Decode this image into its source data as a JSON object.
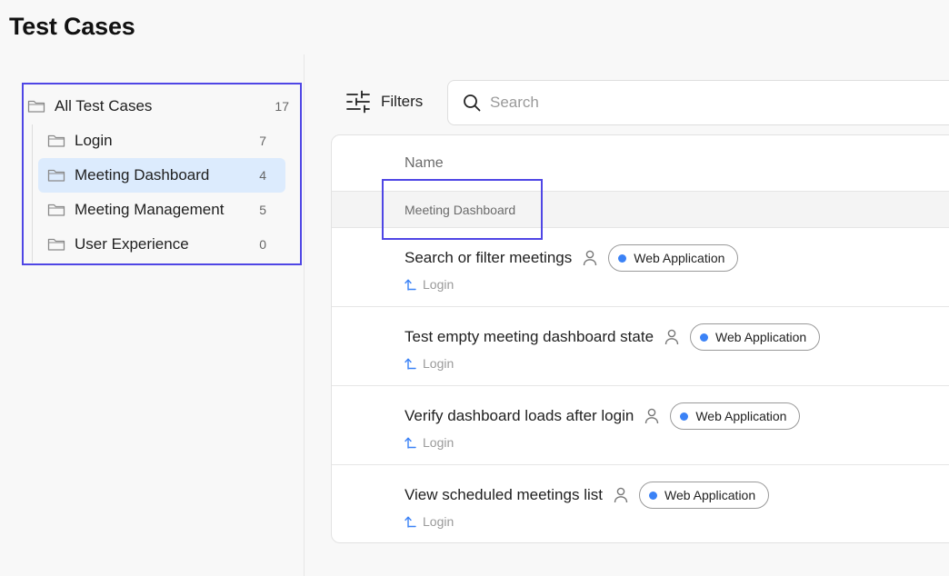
{
  "page": {
    "title": "Test Cases"
  },
  "colors": {
    "accent": "#4f46e5",
    "active_bg": "#dcebfd",
    "badge_dot": "#3b82f6",
    "link_icon": "#3b82f6"
  },
  "sidebar": {
    "root": {
      "label": "All Test Cases",
      "count": "17"
    },
    "items": [
      {
        "label": "Login",
        "count": "7",
        "active": false
      },
      {
        "label": "Meeting Dashboard",
        "count": "4",
        "active": true
      },
      {
        "label": "Meeting Management",
        "count": "5",
        "active": false
      },
      {
        "label": "User Experience",
        "count": "0",
        "active": false
      }
    ]
  },
  "toolbar": {
    "filters_label": "Filters",
    "search": {
      "placeholder": "Search",
      "value": ""
    }
  },
  "table": {
    "column_header": "Name",
    "group": {
      "label": "Meeting Dashboard"
    },
    "rows": [
      {
        "name": "Search or filter meetings",
        "tag": "Web Application",
        "parent": "Login"
      },
      {
        "name": "Test empty meeting dashboard state",
        "tag": "Web Application",
        "parent": "Login"
      },
      {
        "name": "Verify dashboard loads after login",
        "tag": "Web Application",
        "parent": "Login"
      },
      {
        "name": "View scheduled meetings list",
        "tag": "Web Application",
        "parent": "Login"
      }
    ]
  },
  "icons": {
    "folder": "folder-icon",
    "filters": "sliders-icon",
    "search": "search-icon",
    "assignee": "person-icon",
    "parent": "parent-arrow-icon"
  }
}
